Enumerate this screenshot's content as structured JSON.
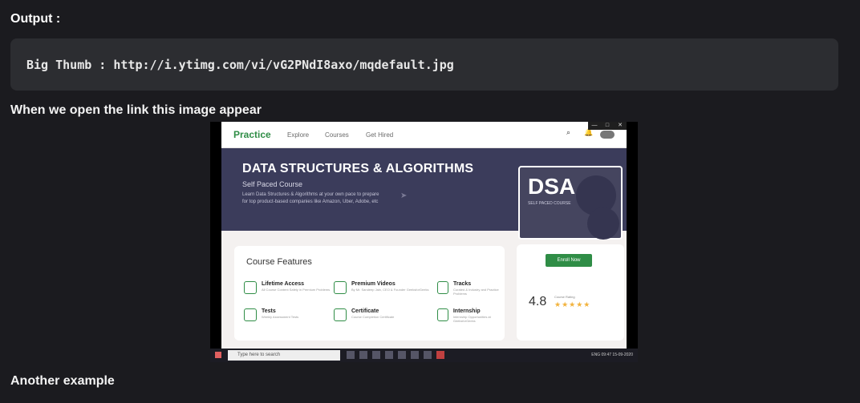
{
  "output_heading": "Output :",
  "code_line": "Big Thumb : http://i.ytimg.com/vi/vG2PNdI8axo/mqdefault.jpg",
  "paragraph": "When we open the link this image appear",
  "footer_text": "Another example",
  "screenshot": {
    "nav": {
      "logo": "Practice",
      "links": [
        "Explore",
        "Courses",
        "Get Hired"
      ]
    },
    "window_controls": [
      "—",
      "□",
      "✕"
    ],
    "banner": {
      "title": "DATA STRUCTURES & ALGORITHMS",
      "subtitle": "Self Paced Course",
      "description": "Learn Data Structures & Algorithms at your own pace to prepare for top product-based companies like Amazon, Uber, Adobe, etc"
    },
    "dsa_card": {
      "big": "DSA",
      "small": "SELF PACED COURSE"
    },
    "features": {
      "title": "Course Features",
      "items": [
        {
          "name": "Lifetime Access",
          "sub": "All Course Content Safely in Premium Problems"
        },
        {
          "name": "Premium Videos",
          "sub": "By Mr. Sandeep Jain, CEO & Founder GeeksforGeeks"
        },
        {
          "name": "Tracks",
          "sub": "Curated & Industry and Practice Problems"
        },
        {
          "name": "Tests",
          "sub": "Weekly Assessment Tests"
        },
        {
          "name": "Certificate",
          "sub": "Course Completion Certificate"
        },
        {
          "name": "Internship",
          "sub": "Internship Opportunities at GeeksforGeeks"
        }
      ]
    },
    "rating": {
      "button": "Enroll Now",
      "score": "4.8",
      "label": "Course Rating",
      "stars": "★★★★★"
    },
    "taskbar": {
      "search": "Type here to search",
      "tray": "ENG  09:47  15-09-2020"
    },
    "colors": {
      "brand_green": "#2f8d46",
      "banner": "#3b3c5b"
    }
  }
}
